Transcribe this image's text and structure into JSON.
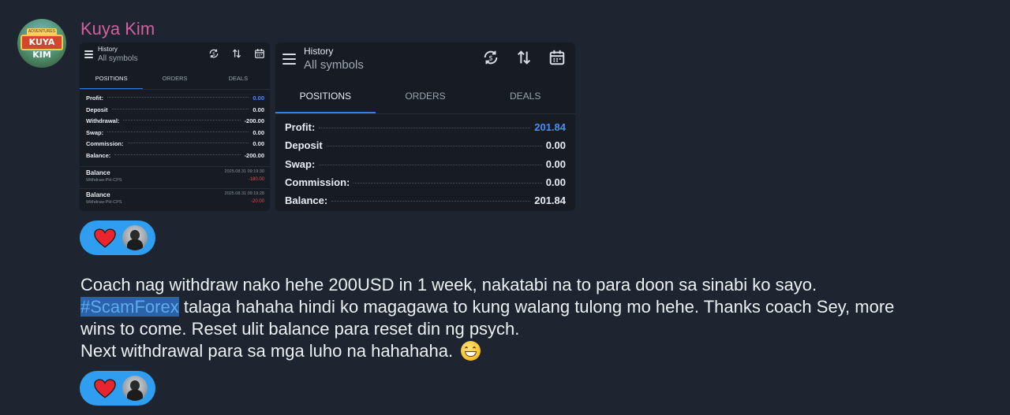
{
  "sender": {
    "name": "Kuya Kim"
  },
  "avatar": {
    "tag_text": "ADVENTURES OF",
    "banner_text": "KUYA KIM"
  },
  "screenshot_small": {
    "header": {
      "title": "History",
      "subtitle": "All symbols"
    },
    "tabs": [
      "POSITIONS",
      "ORDERS",
      "DEALS"
    ],
    "active_tab": "POSITIONS",
    "summary": [
      {
        "label": "Profit:",
        "value": "0.00",
        "highlight": true
      },
      {
        "label": "Deposit",
        "value": "0.00"
      },
      {
        "label": "Withdrawal:",
        "value": "-200.00"
      },
      {
        "label": "Swap:",
        "value": "0.00"
      },
      {
        "label": "Commission:",
        "value": "0.00"
      },
      {
        "label": "Balance:",
        "value": "-200.00"
      }
    ],
    "deals": [
      {
        "name": "Balance",
        "sub": "Withdraw-PH-CPS",
        "date": "2025.08.31 09:19:30",
        "amount": "-180.00"
      },
      {
        "name": "Balance",
        "sub": "Withdraw-PH-CPS",
        "date": "2025.08.31 09:19:28",
        "amount": "-20.00"
      }
    ]
  },
  "screenshot_large": {
    "header": {
      "title": "History",
      "subtitle": "All symbols"
    },
    "tabs": [
      "POSITIONS",
      "ORDERS",
      "DEALS"
    ],
    "active_tab": "POSITIONS",
    "summary": [
      {
        "label": "Profit:",
        "value": "201.84",
        "highlight": true
      },
      {
        "label": "Deposit",
        "value": "0.00"
      },
      {
        "label": "Swap:",
        "value": "0.00"
      },
      {
        "label": "Commission:",
        "value": "0.00"
      },
      {
        "label": "Balance:",
        "value": "201.84"
      }
    ]
  },
  "message": {
    "line1": "Coach nag withdraw nako hehe 200USD in 1 week, nakatabi na to para doon sa sinabi ko sayo.",
    "hashtag": "#ScamForex",
    "line2_rest": " talaga hahaha hindi ko magagawa to kung walang tulong mo hehe. Thanks coach Sey, more",
    "line3": "wins to come. Reset ulit balance para reset din ng psych.",
    "line4": "Next withdrawal para sa mga luho na hahahaha."
  },
  "reactions": [
    {
      "emoji": "heart",
      "count_avatars": 1
    },
    {
      "emoji": "heart",
      "count_avatars": 1
    }
  ],
  "colors": {
    "background": "#1e2530",
    "sender_name": "#d1619d",
    "reaction_pill": "#2f9ef0",
    "hashtag_highlight": "#2a63a8",
    "profit_blue": "#4a8ff0",
    "negative_red": "#e0504a"
  }
}
